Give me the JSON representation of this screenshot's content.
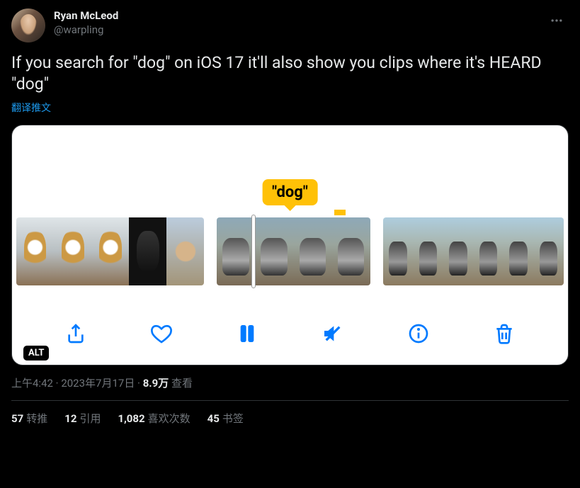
{
  "author": {
    "display_name": "Ryan McLeod",
    "handle": "@warpling"
  },
  "tweet": {
    "text": "If you search for \"dog\" on iOS 17 it'll also show you clips where it's HEARD \"dog\"",
    "translate_label": "翻译推文"
  },
  "media": {
    "tooltip": "\"dog\"",
    "alt_badge": "ALT",
    "controls": {
      "share": "share",
      "like": "like",
      "pause": "pause",
      "mute": "mute",
      "info": "info",
      "trash": "trash"
    }
  },
  "meta": {
    "time": "上午4:42",
    "date": "2023年7月17日",
    "views_count": "8.9万",
    "views_label": "查看",
    "separator": " · "
  },
  "stats": {
    "retweets": {
      "count": "57",
      "label": "转推"
    },
    "quotes": {
      "count": "12",
      "label": "引用"
    },
    "likes": {
      "count": "1,082",
      "label": "喜欢次数"
    },
    "bookmarks": {
      "count": "45",
      "label": "书签"
    }
  }
}
